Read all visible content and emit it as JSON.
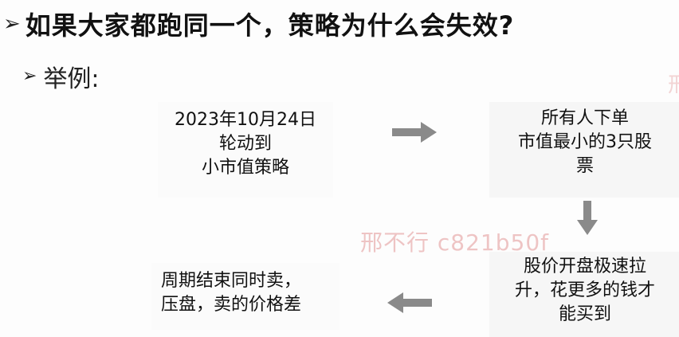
{
  "slide": {
    "title": "如果大家都跑同一个，策略为什么会失效?",
    "subtitle": "举例:",
    "bullet_glyph": "➢",
    "flow": {
      "step1": {
        "lines": [
          "2023年10月24日",
          "轮动到",
          "小市值策略"
        ]
      },
      "step2": {
        "lines": [
          "所有人下单",
          "市值最小的3只股",
          "票"
        ]
      },
      "step3": {
        "lines": [
          "股价开盘极速拉",
          "升，花更多的钱才",
          "能买到"
        ]
      },
      "step4": {
        "lines": [
          "周期结束同时卖，",
          "压盘，卖的价格差"
        ]
      }
    },
    "watermark": "邢不行 c821b50f",
    "watermark_edge": "邢"
  },
  "colors": {
    "arrow": "#8a8a8a",
    "watermark": "#e29696"
  }
}
